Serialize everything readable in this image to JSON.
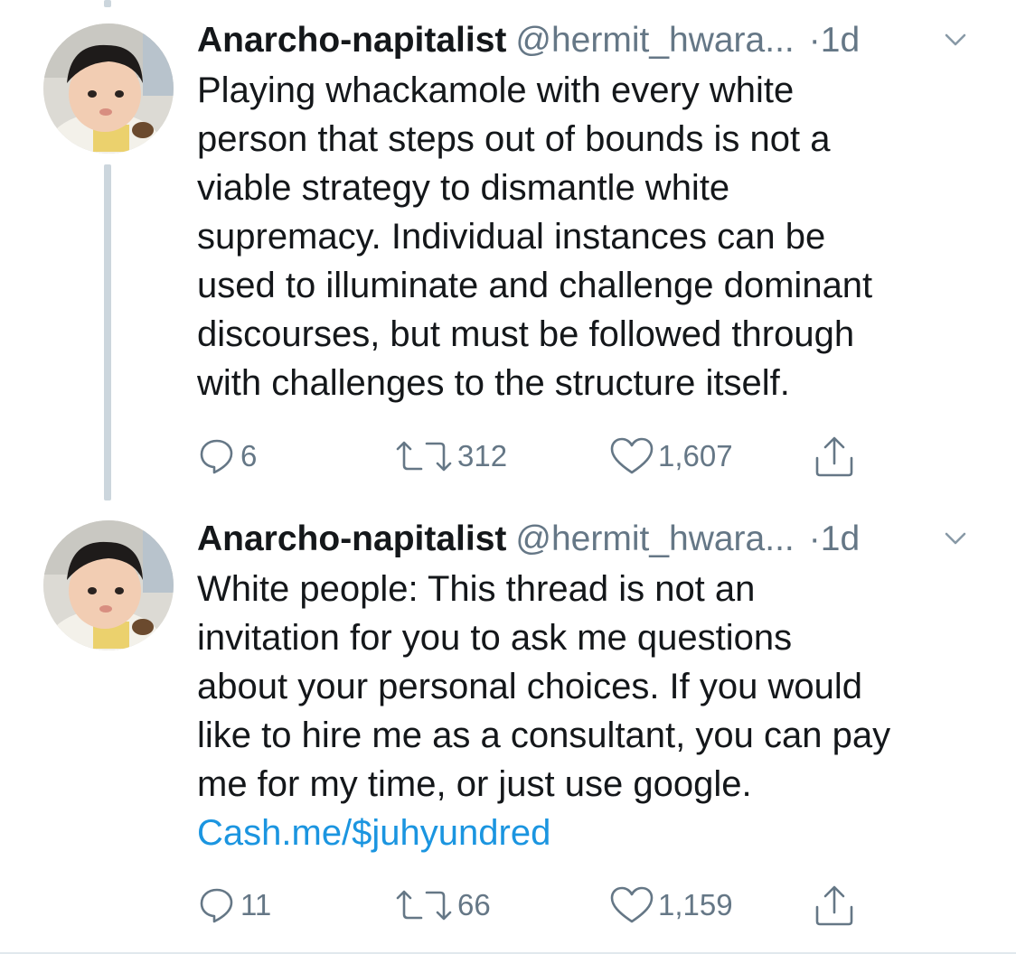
{
  "tweets": [
    {
      "name": "Anarcho-napitalist",
      "handle": "@hermit_hwara...",
      "dot": "·",
      "time": "1d",
      "body_lines": [
        "Playing whackamole with every white",
        "person that steps out of bounds is not a",
        "viable strategy to dismantle white",
        "supremacy. Individual instances can be",
        "used to illuminate and challenge dominant",
        "discourses, but must be followed through",
        "with challenges to the structure itself."
      ],
      "link": "",
      "replies": "6",
      "retweets": "312",
      "likes": "1,607"
    },
    {
      "name": "Anarcho-napitalist",
      "handle": "@hermit_hwara...",
      "dot": "·",
      "time": "1d",
      "body_lines": [
        "White people: This thread is not an",
        "invitation for you to ask me questions",
        "about your personal choices. If you would",
        "like to hire me as a consultant, you can pay",
        "me for my time, or just use google."
      ],
      "link": "Cash.me/$juhyundred",
      "replies": "11",
      "retweets": "66",
      "likes": "1,159"
    }
  ],
  "icons": {
    "reply": "reply-icon",
    "retweet": "retweet-icon",
    "like": "heart-icon",
    "share": "share-icon",
    "caret": "chevron-down-icon"
  },
  "colors": {
    "text": "#14171a",
    "secondary": "#657786",
    "link": "#1b95e0",
    "thread_line": "#ccd6dd"
  }
}
